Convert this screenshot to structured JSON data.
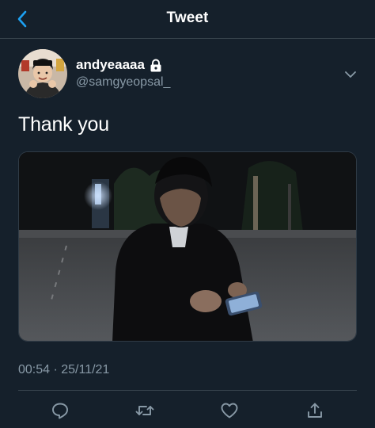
{
  "header": {
    "title": "Tweet",
    "back_icon": "chevron-left-icon"
  },
  "author": {
    "display_name": "andyeaaaa",
    "handle": "@samgyeopsal_",
    "protected_icon": "lock-icon",
    "more_icon": "chevron-down-icon"
  },
  "tweet": {
    "text": "Thank you",
    "timestamp": "00:54 · 25/11/21"
  },
  "actions": {
    "reply_icon": "reply-icon",
    "retweet_icon": "retweet-icon",
    "like_icon": "heart-icon",
    "share_icon": "share-icon"
  },
  "colors": {
    "background": "#15202b",
    "accent": "#1da1f2",
    "secondary_text": "#8899a6",
    "divider": "#38444d"
  }
}
